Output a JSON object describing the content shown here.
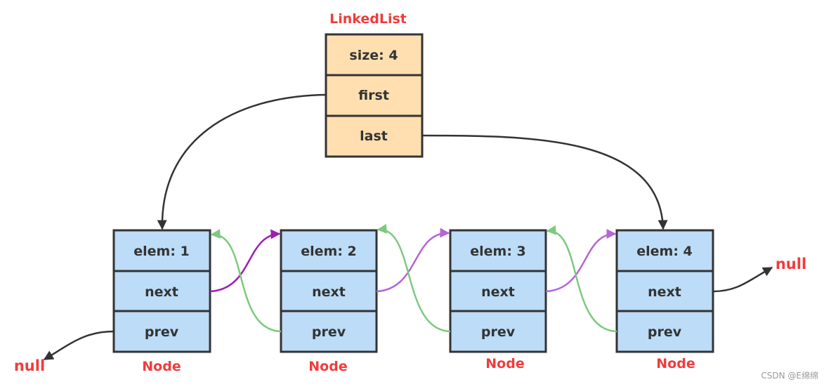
{
  "linked_list": {
    "title": "LinkedList",
    "fields": [
      "size: 4",
      "first",
      "last"
    ],
    "fill_color": "#ffdfb0"
  },
  "nodes": [
    {
      "label": "Node",
      "fields": [
        "elem: 1",
        "next",
        "prev"
      ]
    },
    {
      "label": "Node",
      "fields": [
        "elem: 2",
        "next",
        "prev"
      ]
    },
    {
      "label": "Node",
      "fields": [
        "elem: 3",
        "next",
        "prev"
      ]
    },
    {
      "label": "Node",
      "fields": [
        "elem: 4",
        "next",
        "prev"
      ]
    }
  ],
  "node_fill_color": "#bcdcf7",
  "border_color": "#333333",
  "label_color": "#f03c3c",
  "arrow_colors": {
    "pointer": "#333333",
    "next_first": "#9c1fb5",
    "next": "#b565d6",
    "prev": "#7dc97f"
  },
  "null_left": "null",
  "null_right": "null",
  "watermark": "CSDN @E绵绵"
}
